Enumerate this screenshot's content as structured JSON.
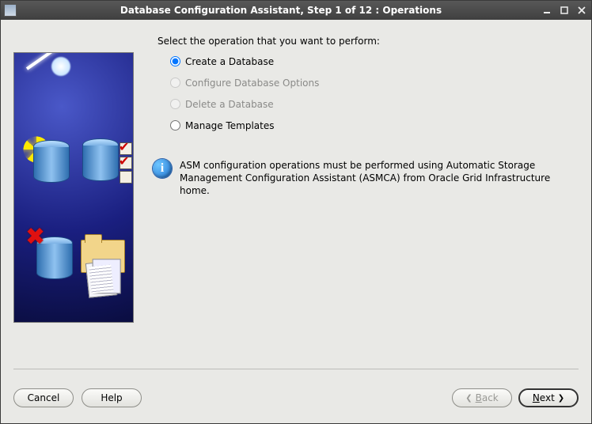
{
  "window": {
    "title": "Database Configuration Assistant, Step 1 of 12 : Operations"
  },
  "instruction": "Select the operation that you want to perform:",
  "options": {
    "create": {
      "label": "Create a Database",
      "enabled": true,
      "selected": true
    },
    "configure": {
      "label": "Configure Database Options",
      "enabled": false,
      "selected": false
    },
    "delete": {
      "label": "Delete a Database",
      "enabled": false,
      "selected": false
    },
    "templates": {
      "label": "Manage Templates",
      "enabled": true,
      "selected": false
    }
  },
  "info": {
    "text": "ASM configuration operations must be performed using Automatic Storage Management Configuration Assistant (ASMCA) from Oracle Grid Infrastructure home."
  },
  "buttons": {
    "cancel": "Cancel",
    "help": "Help",
    "back": "Back",
    "next": "Next",
    "back_mnemonic": "B",
    "next_mnemonic": "N"
  }
}
